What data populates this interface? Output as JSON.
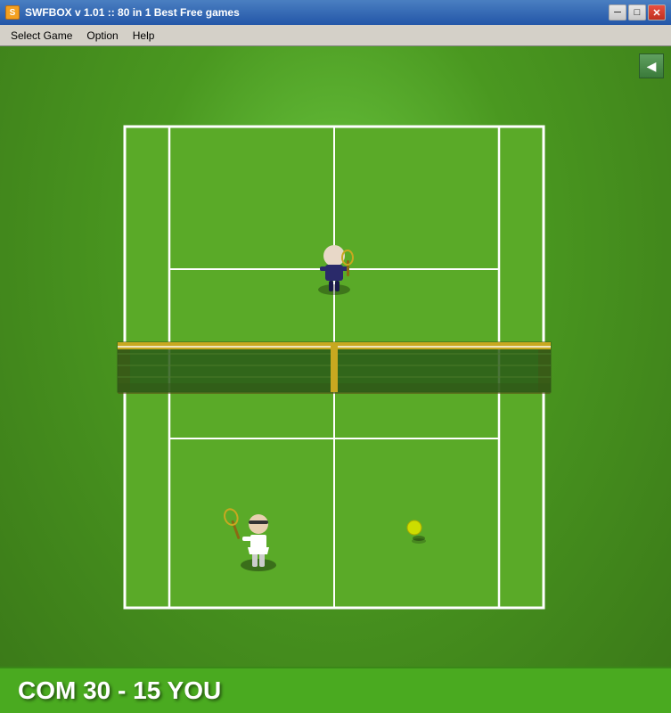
{
  "window": {
    "title": "SWFBOX v 1.01  ::  80 in 1 Best Free games",
    "icon_label": "S"
  },
  "titlebar": {
    "minimize_label": "─",
    "maximize_label": "□",
    "close_label": "✕"
  },
  "menubar": {
    "items": [
      {
        "label": "Select Game"
      },
      {
        "label": "Option"
      },
      {
        "label": "Help"
      }
    ]
  },
  "score": {
    "text": "COM 30 - 15 YOU"
  },
  "back_button": {
    "symbol": "◀"
  }
}
